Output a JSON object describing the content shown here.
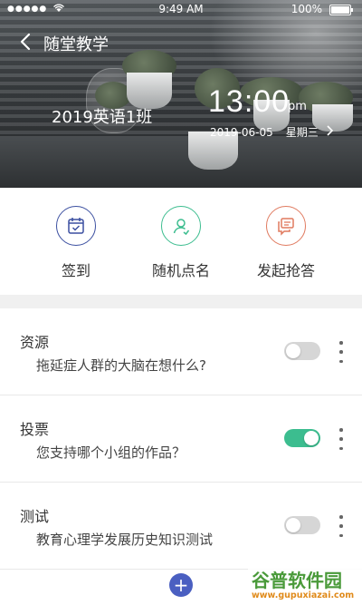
{
  "status_bar": {
    "signal": "●●●●●",
    "time": "9:49 AM",
    "battery": "100%"
  },
  "nav": {
    "title": "随堂教学"
  },
  "hero": {
    "class_name": "2019英语1班",
    "time": "13:00",
    "ampm": "pm",
    "date": "2019-06-05",
    "weekday": "星期三"
  },
  "actions": [
    {
      "label": "签到",
      "icon": "calendar-check-icon",
      "color": "#3b4fa0"
    },
    {
      "label": "随机点名",
      "icon": "user-random-icon",
      "color": "#3cbd8f"
    },
    {
      "label": "发起抢答",
      "icon": "chat-bubble-icon",
      "color": "#e07a5f"
    }
  ],
  "list": [
    {
      "title": "资源",
      "subtitle": "拖延症人群的大脑在想什么?",
      "toggle": "off"
    },
    {
      "title": "投票",
      "subtitle": "您支持哪个小组的作品？",
      "toggle": "on"
    },
    {
      "title": "测试",
      "subtitle": "教育心理学发展历史知识测试",
      "toggle": "off"
    }
  ],
  "fab": {
    "label": "+"
  },
  "watermark": {
    "brand": "谷普软件园",
    "url": "www.gupuxiazai.com"
  },
  "colors": {
    "accent_green": "#3cbd8f",
    "accent_blue": "#4a5fc1",
    "toggle_off": "#d6d6d6"
  }
}
